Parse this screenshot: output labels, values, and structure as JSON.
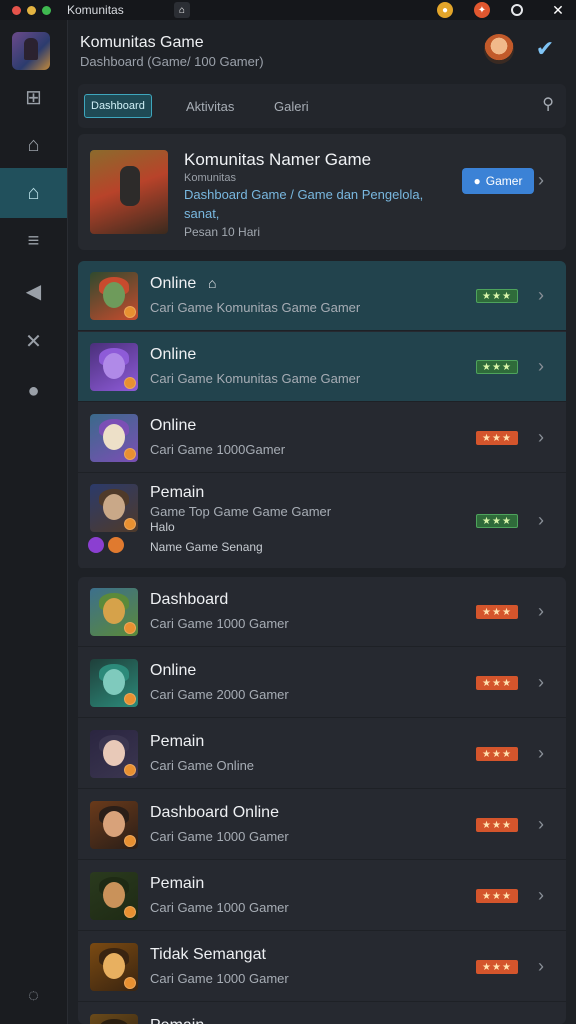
{
  "titlebar": {
    "app_title": "Komunitas",
    "traffic_colors": [
      "#e5534b",
      "#e3b341",
      "#3fb950"
    ]
  },
  "sidebar": {
    "items": [
      {
        "icon": "gamepad-icon",
        "glyph": "⊞",
        "active": false
      },
      {
        "icon": "home-icon",
        "glyph": "⌂",
        "active": false
      },
      {
        "icon": "house-outline-icon",
        "glyph": "⌂",
        "active": true
      },
      {
        "icon": "list-icon",
        "glyph": "≡",
        "active": false
      },
      {
        "icon": "megaphone-icon",
        "glyph": "◀",
        "active": false
      },
      {
        "icon": "tools-icon",
        "glyph": "✕",
        "active": false
      },
      {
        "icon": "location-pin-icon",
        "glyph": "●",
        "active": false
      }
    ],
    "bottom_glyph": "◌"
  },
  "header": {
    "title": "Komunitas Game",
    "subtitle": "Dashboard (Game/ 100 Gamer)"
  },
  "tabs": {
    "items": [
      "Dashboard",
      "Aktivitas",
      "Galeri"
    ]
  },
  "featured": {
    "title": "Komunitas Namer Game",
    "caption": "Komunitas",
    "description": "Dashboard Game / Game dan Pengelola, sanat,",
    "meta": "Pesan 10 Hari",
    "button_label": "Gamer"
  },
  "rows": [
    {
      "title": "Online",
      "sub": "Cari Game Komunitas Game Gamer",
      "badge": "★★★",
      "badge_color": "green",
      "highlight": true,
      "home": true,
      "palette": [
        "#2f4a2e",
        "#6e9b5b",
        "#c84b2e"
      ]
    },
    {
      "title": "Online",
      "sub": "Cari Game Komunitas Game Gamer",
      "badge": "★★★",
      "badge_color": "green",
      "highlight": true,
      "home": false,
      "palette": [
        "#4a2f7a",
        "#b08ae8",
        "#8e5bd8"
      ]
    },
    {
      "title": "Online",
      "sub": "Cari Game 1000Gamer",
      "badge": "★★★",
      "badge_color": "orange",
      "highlight": false,
      "home": false,
      "palette": [
        "#3a6a8a",
        "#ede0c8",
        "#7b4fb5"
      ]
    },
    {
      "title": "Pemain",
      "sub": "Game Top Game Game Gamer",
      "extra": "Halo",
      "extra2": "Name Game Senang",
      "badge": "★★★",
      "badge_color": "green",
      "highlight": false,
      "home": false,
      "palette": [
        "#2b3a6a",
        "#c9a888",
        "#4f3a2a"
      ]
    },
    {
      "title": "Dashboard",
      "sub": "Cari Game 1000 Gamer",
      "badge": "★★★",
      "badge_color": "orange",
      "highlight": false,
      "home": false,
      "palette": [
        "#3c6f8c",
        "#d6a24a",
        "#5b8a3a"
      ]
    },
    {
      "title": "Online",
      "sub": "Cari Game 2000 Gamer",
      "badge": "★★★",
      "badge_color": "orange",
      "highlight": false,
      "home": false,
      "palette": [
        "#1f3f3a",
        "#7fcabd",
        "#2c8a7a"
      ]
    },
    {
      "title": "Pemain",
      "sub": "Cari Game Online",
      "badge": "★★★",
      "badge_color": "orange",
      "highlight": false,
      "home": false,
      "palette": [
        "#2a2540",
        "#e8c9b8",
        "#3b3650"
      ]
    },
    {
      "title": "Dashboard Online",
      "sub": "Cari Game 1000 Gamer",
      "badge": "★★★",
      "badge_color": "orange",
      "highlight": false,
      "home": false,
      "palette": [
        "#6a3a1a",
        "#d8a27a",
        "#2a1e18"
      ]
    },
    {
      "title": "Pemain",
      "sub": "Cari Game 1000 Gamer",
      "badge": "★★★",
      "badge_color": "orange",
      "highlight": false,
      "home": false,
      "palette": [
        "#2a3a1e",
        "#c9925a",
        "#1e2a14"
      ]
    },
    {
      "title": "Tidak Semangat",
      "sub": "Cari Game 1000 Gamer",
      "badge": "★★★",
      "badge_color": "orange",
      "highlight": false,
      "home": false,
      "palette": [
        "#7a4a12",
        "#e8b060",
        "#3a2410"
      ]
    },
    {
      "title": "Pemain",
      "sub": "",
      "badge": "",
      "badge_color": "orange",
      "highlight": false,
      "home": false,
      "palette": [
        "#6a4a1a",
        "#d8a060",
        "#2a1e10"
      ]
    }
  ]
}
